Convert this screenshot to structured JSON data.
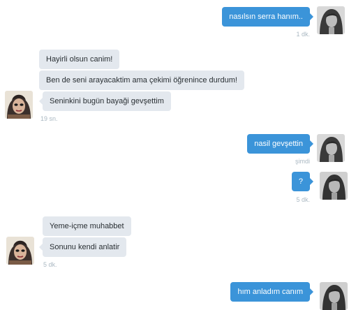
{
  "conversation": {
    "messages": [
      {
        "side": "out",
        "text": "nasılsın serra hanım..",
        "timestamp": "1 dk."
      },
      {
        "side": "in",
        "text": "Hayirli olsun canim!"
      },
      {
        "side": "in",
        "text": "Ben de seni arayacaktim ama çekimi öğrenince durdum!"
      },
      {
        "side": "in",
        "text": "Seninkini bugün bayaği gevşettim",
        "timestamp": "19 sn."
      },
      {
        "side": "out",
        "text": "nasil gevşettin",
        "timestamp": "şimdi"
      },
      {
        "side": "out",
        "text": "?",
        "timestamp": "5 dk."
      },
      {
        "side": "in",
        "text": "Yeme-içme muhabbet"
      },
      {
        "side": "in",
        "text": "Sonunu kendi anlatir",
        "timestamp": "5 dk."
      },
      {
        "side": "out",
        "text": "hım anladım canım"
      }
    ]
  },
  "colors": {
    "outgoing_bubble": "#3b94d9",
    "incoming_bubble": "#e3e8ee",
    "timestamp": "#aab8c2"
  },
  "icons": {
    "self_avatar": "woman-bw-photo-avatar",
    "contact_avatar": "heavy-makeup-photo-avatar"
  }
}
